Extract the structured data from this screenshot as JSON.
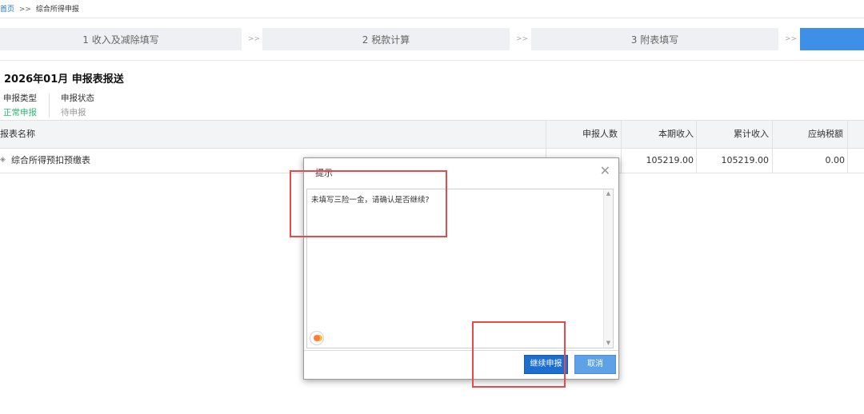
{
  "breadcrumb": {
    "home": "首页",
    "separator": ">>",
    "current": "综合所得申报"
  },
  "steps": [
    {
      "label": "1 收入及减除填写"
    },
    {
      "label": "2 税款计算"
    },
    {
      "label": "3 附表填写"
    },
    {
      "label": ""
    }
  ],
  "step_arrow": ">>",
  "period_title": "2026年01月  申报表报送",
  "info": {
    "type_label": "申报类型",
    "type_value": "正常申报",
    "status_label": "申报状态",
    "status_value": "待申报"
  },
  "table": {
    "headers": {
      "name": "报表名称",
      "count": "申报人数",
      "current_income": "本期收入",
      "cumulative_income": "累计收入",
      "tax_payable": "应纳税额"
    },
    "rows": [
      {
        "name": "综合所得预扣预缴表",
        "count": "",
        "current_income": "105219.00",
        "cumulative_income": "105219.00",
        "tax_payable": "0.00"
      }
    ]
  },
  "dialog": {
    "title": "提示",
    "message": "未填写三险一金，请确认是否继续?",
    "primary_button": "继续申报",
    "cancel_button": "取消"
  },
  "colors": {
    "accent": "#3d8fe8",
    "primary_button": "#1c6fd1",
    "highlight": "#e74a4a",
    "success": "#2eb872"
  }
}
